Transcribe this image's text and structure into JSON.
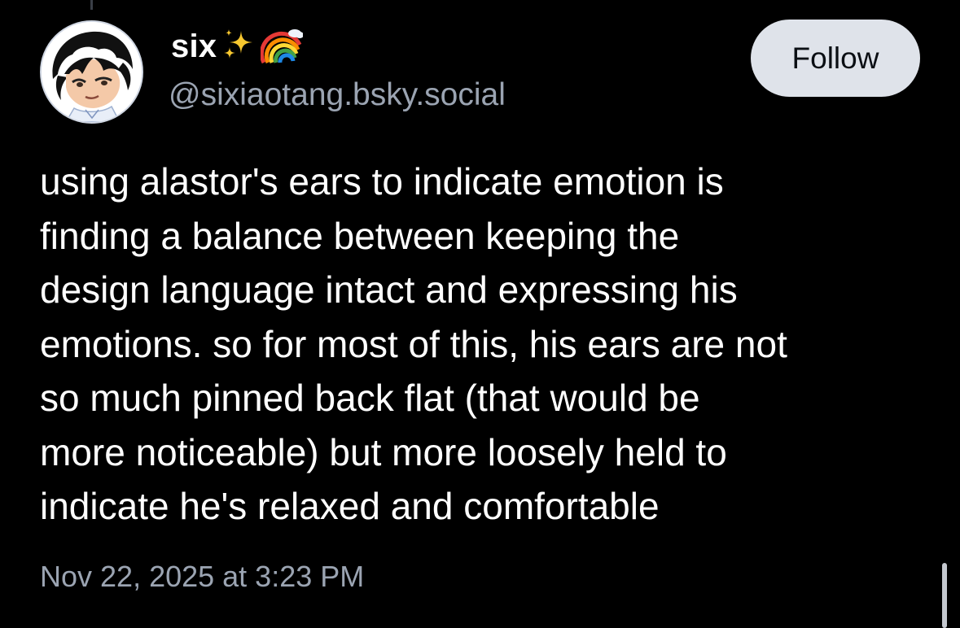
{
  "post": {
    "author": {
      "display_name": "six",
      "handle": "@sixiaotang.bsky.social",
      "avatar_icon": "avatar-drawing-icon",
      "name_emojis": [
        "sparkles-icon",
        "rainbow-icon"
      ]
    },
    "follow_label": "Follow",
    "text_lines": [
      "using alastor's ears to indicate emotion is",
      "finding a balance between keeping the",
      "design language intact and expressing his",
      "emotions. so for most of this, his ears are not",
      "so much pinned back flat (that would be",
      "more noticeable) but more loosely held to",
      "indicate he's relaxed and comfortable"
    ],
    "timestamp": "Nov 22, 2025 at 3:23 PM"
  },
  "colors": {
    "background": "#000000",
    "text": "#ffffff",
    "muted_text": "#9ba4b2",
    "follow_button_bg": "#dfe3ea",
    "follow_button_text": "#0b0f14"
  }
}
